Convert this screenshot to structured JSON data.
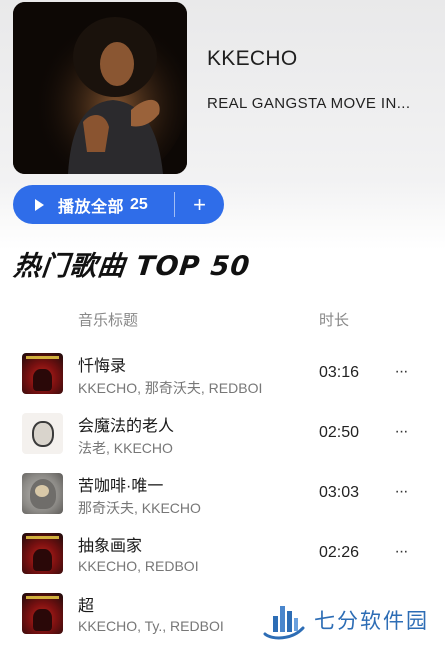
{
  "artist": {
    "name": "KKECHO",
    "album_title": "REAL GANGSTA MOVE IN..."
  },
  "play_all": {
    "label": "播放全部",
    "count": "25",
    "add_icon": "+"
  },
  "section_title": "热门歌曲 TOP 50",
  "table_header": {
    "title_col": "音乐标题",
    "duration_col": "时长"
  },
  "songs": [
    {
      "name": "忏悔录",
      "artists": "KKECHO, 那奇沃夫, REDBOI",
      "duration": "03:16",
      "more": "···"
    },
    {
      "name": "会魔法的老人",
      "artists": "法老, KKECHO",
      "duration": "02:50",
      "more": "···"
    },
    {
      "name": "苦咖啡·唯一",
      "artists": "那奇沃夫, KKECHO",
      "duration": "03:03",
      "more": "···"
    },
    {
      "name": "抽象画家",
      "artists": "KKECHO, REDBOI",
      "duration": "02:26",
      "more": "···"
    },
    {
      "name": "超",
      "artists": "KKECHO, Ty., REDBOI",
      "duration": "",
      "more": ""
    }
  ],
  "watermark": {
    "text": "七分软件园"
  },
  "colors": {
    "accent": "#2f6de9",
    "watermark": "#2d6db5"
  }
}
